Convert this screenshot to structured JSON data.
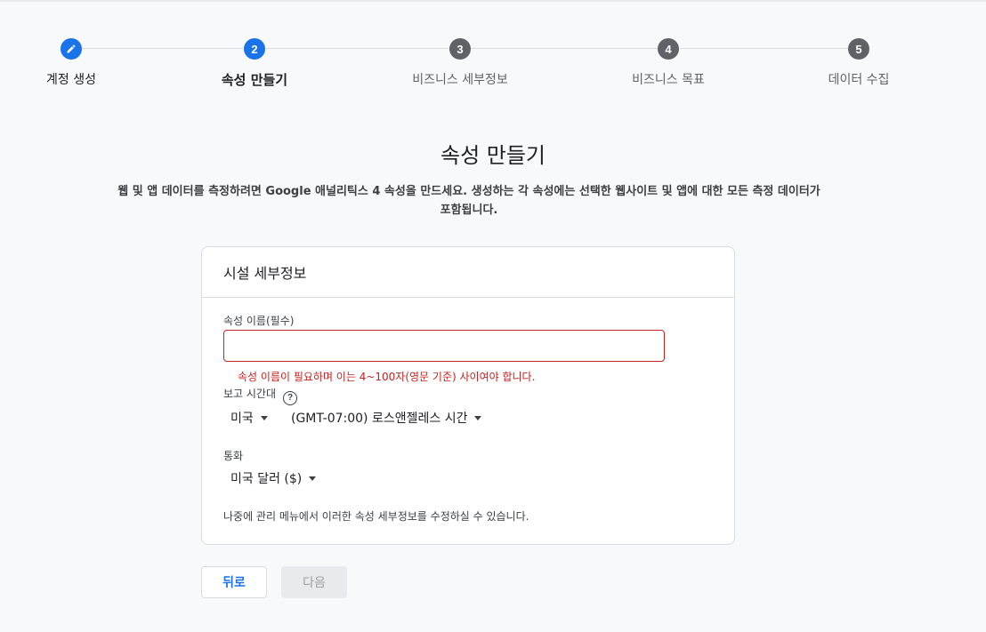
{
  "stepper": {
    "steps": [
      {
        "number": "",
        "label": "계정 생성",
        "state": "done"
      },
      {
        "number": "2",
        "label": "속성 만들기",
        "state": "current"
      },
      {
        "number": "3",
        "label": "비즈니스 세부정보",
        "state": "upcoming"
      },
      {
        "number": "4",
        "label": "비즈니스 목표",
        "state": "upcoming"
      },
      {
        "number": "5",
        "label": "데이터 수집",
        "state": "upcoming"
      }
    ]
  },
  "header": {
    "title": "속성 만들기",
    "description": "웹 및 앱 데이터를 측정하려면 Google 애널리틱스 4 속성을 만드세요. 생성하는 각 속성에는 선택한 웹사이트 및 앱에 대한 모든 측정 데이터가 포함됩니다."
  },
  "card": {
    "title": "시설 세부정보",
    "property_name_label": "속성 이름(필수)",
    "property_name_value": "",
    "property_name_error": "속성 이름이 필요하며 이는 4~100자(영문 기준) 사이여야 합니다.",
    "timezone_label": "보고 시간대",
    "help_icon_glyph": "?",
    "country_value": "미국",
    "timezone_value": "(GMT-07:00) 로스앤젤레스 시간",
    "currency_label": "통화",
    "currency_value": "미국 달러 ($)",
    "note": "나중에 관리 메뉴에서 이러한 속성 세부정보를 수정하실 수 있습니다."
  },
  "buttons": {
    "back_label": "뒤로",
    "next_label": "다음"
  },
  "colors": {
    "accent": "#1a73e8",
    "error": "#c5221f",
    "inactive_step": "#5f6368"
  },
  "icons": {
    "step1": "pencil-icon",
    "help": "help-circle-icon",
    "dropdown": "caret-down-icon"
  }
}
